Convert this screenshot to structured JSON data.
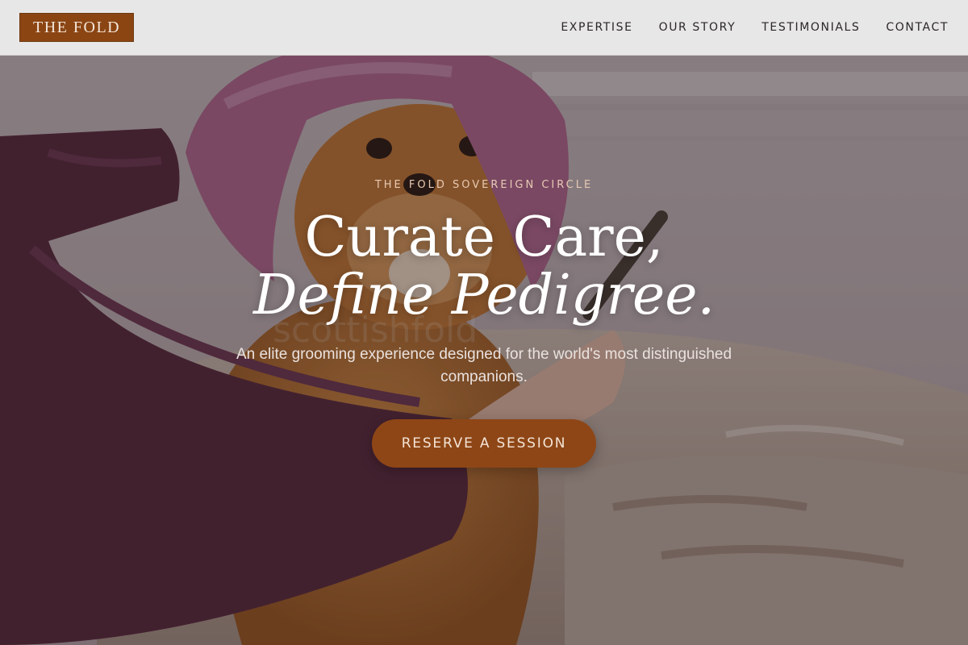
{
  "header": {
    "logo": "THE FOLD",
    "nav": [
      {
        "label": "EXPERTISE"
      },
      {
        "label": "OUR STORY"
      },
      {
        "label": "TESTIMONIALS"
      },
      {
        "label": "CONTACT"
      }
    ]
  },
  "hero": {
    "eyebrow": "THE FOLD SOVEREIGN CIRCLE",
    "headline_line1": "Curate Care,",
    "headline_line2": "Define Pedigree.",
    "subtext": "An elite grooming experience designed for the world's most distinguished companions.",
    "cta_label": "RESERVE A SESSION",
    "photo_watermark": "scottishfold"
  },
  "colors": {
    "brand": "#8b4513",
    "cta": "#8e4616",
    "header_bg": "#e8e7e8"
  }
}
